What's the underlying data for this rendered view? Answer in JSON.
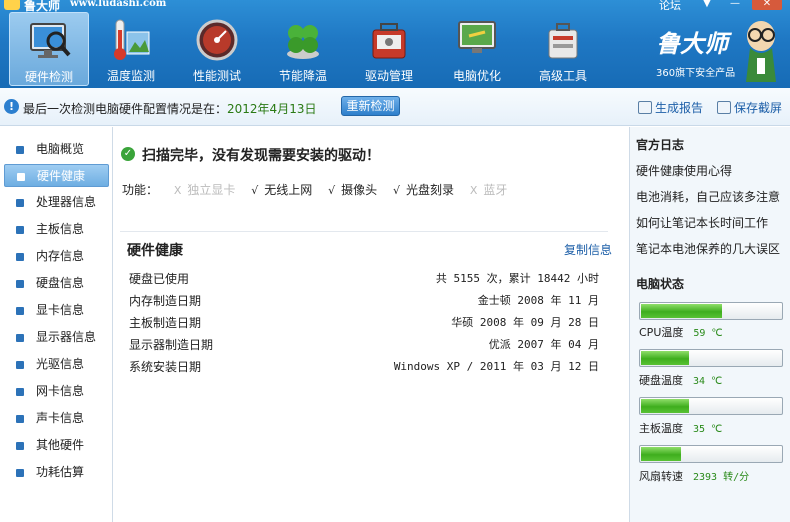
{
  "window": {
    "title": "鲁大师",
    "url": "www.ludashi.com",
    "forum_link": "论坛",
    "menu_glyph": "▼",
    "minimize_glyph": "—",
    "close_glyph": "✕"
  },
  "toolbar": {
    "items": [
      {
        "label": "硬件检测",
        "icon": "monitor-magnifier-icon",
        "active": true
      },
      {
        "label": "温度监测",
        "icon": "thermometer-icon"
      },
      {
        "label": "性能测试",
        "icon": "speedometer-icon"
      },
      {
        "label": "节能降温",
        "icon": "clover-icon"
      },
      {
        "label": "驱动管理",
        "icon": "toolbox-icon"
      },
      {
        "label": "电脑优化",
        "icon": "screen-broom-icon"
      },
      {
        "label": "高级工具",
        "icon": "tool-case-icon"
      }
    ]
  },
  "brand": {
    "name": "鲁大师",
    "tagline": "360旗下安全产品"
  },
  "infobar": {
    "text": "最后一次检测电脑硬件配置情况是在：",
    "date": "2012年4月13日",
    "recheck_label": "重新检测",
    "report_label": "生成报告",
    "screenshot_label": "保存截屏"
  },
  "sidebar": {
    "items": [
      {
        "label": "电脑概览"
      },
      {
        "label": "硬件健康",
        "active": true
      },
      {
        "label": "处理器信息"
      },
      {
        "label": "主板信息"
      },
      {
        "label": "内存信息"
      },
      {
        "label": "硬盘信息"
      },
      {
        "label": "显卡信息"
      },
      {
        "label": "显示器信息"
      },
      {
        "label": "光驱信息"
      },
      {
        "label": "网卡信息"
      },
      {
        "label": "声卡信息"
      },
      {
        "label": "其他硬件"
      },
      {
        "label": "功耗估算"
      }
    ]
  },
  "main": {
    "scan_message": "扫描完毕，没有发现需要安装的驱动！",
    "features_label": "功能：",
    "features": [
      {
        "label": "独立显卡",
        "available": false,
        "mark": "X"
      },
      {
        "label": "无线上网",
        "available": true,
        "mark": "√"
      },
      {
        "label": "摄像头",
        "available": true,
        "mark": "√"
      },
      {
        "label": "光盘刻录",
        "available": true,
        "mark": "√"
      },
      {
        "label": "蓝牙",
        "available": false,
        "mark": "X"
      }
    ],
    "section_title": "硬件健康",
    "copy_label": "复制信息",
    "rows": [
      {
        "key": "硬盘已使用",
        "value": "共 5155 次，累计 18442 小时"
      },
      {
        "key": "内存制造日期",
        "value": "金士顿 2008 年 11 月"
      },
      {
        "key": "主板制造日期",
        "value": "华硕 2008 年 09 月 28 日"
      },
      {
        "key": "显示器制造日期",
        "value": "优派 2007 年 04 月"
      },
      {
        "key": "系统安装日期",
        "value": "Windows XP / 2011 年 03 月 12 日"
      }
    ]
  },
  "right_panel": {
    "blog_title": "官方日志",
    "blog_links": [
      "硬件健康使用心得",
      "电池消耗，自己应该多注意",
      "如何让笔记本长时间工作",
      "笔记本电池保养的几大误区"
    ],
    "status_title": "电脑状态",
    "gauges": [
      {
        "label": "CPU温度",
        "value": "59 ℃",
        "level": 0.57
      },
      {
        "label": "硬盘温度",
        "value": "34 ℃",
        "level": 0.34
      },
      {
        "label": "主板温度",
        "value": "35 ℃",
        "level": 0.34
      },
      {
        "label": "风扇转速",
        "value": "2393 转/分",
        "level": 0.28
      }
    ]
  },
  "colors": {
    "toolbar_blue": "#1f78c4",
    "accent_green": "#3fae1e",
    "link_blue": "#1d5fa8"
  }
}
